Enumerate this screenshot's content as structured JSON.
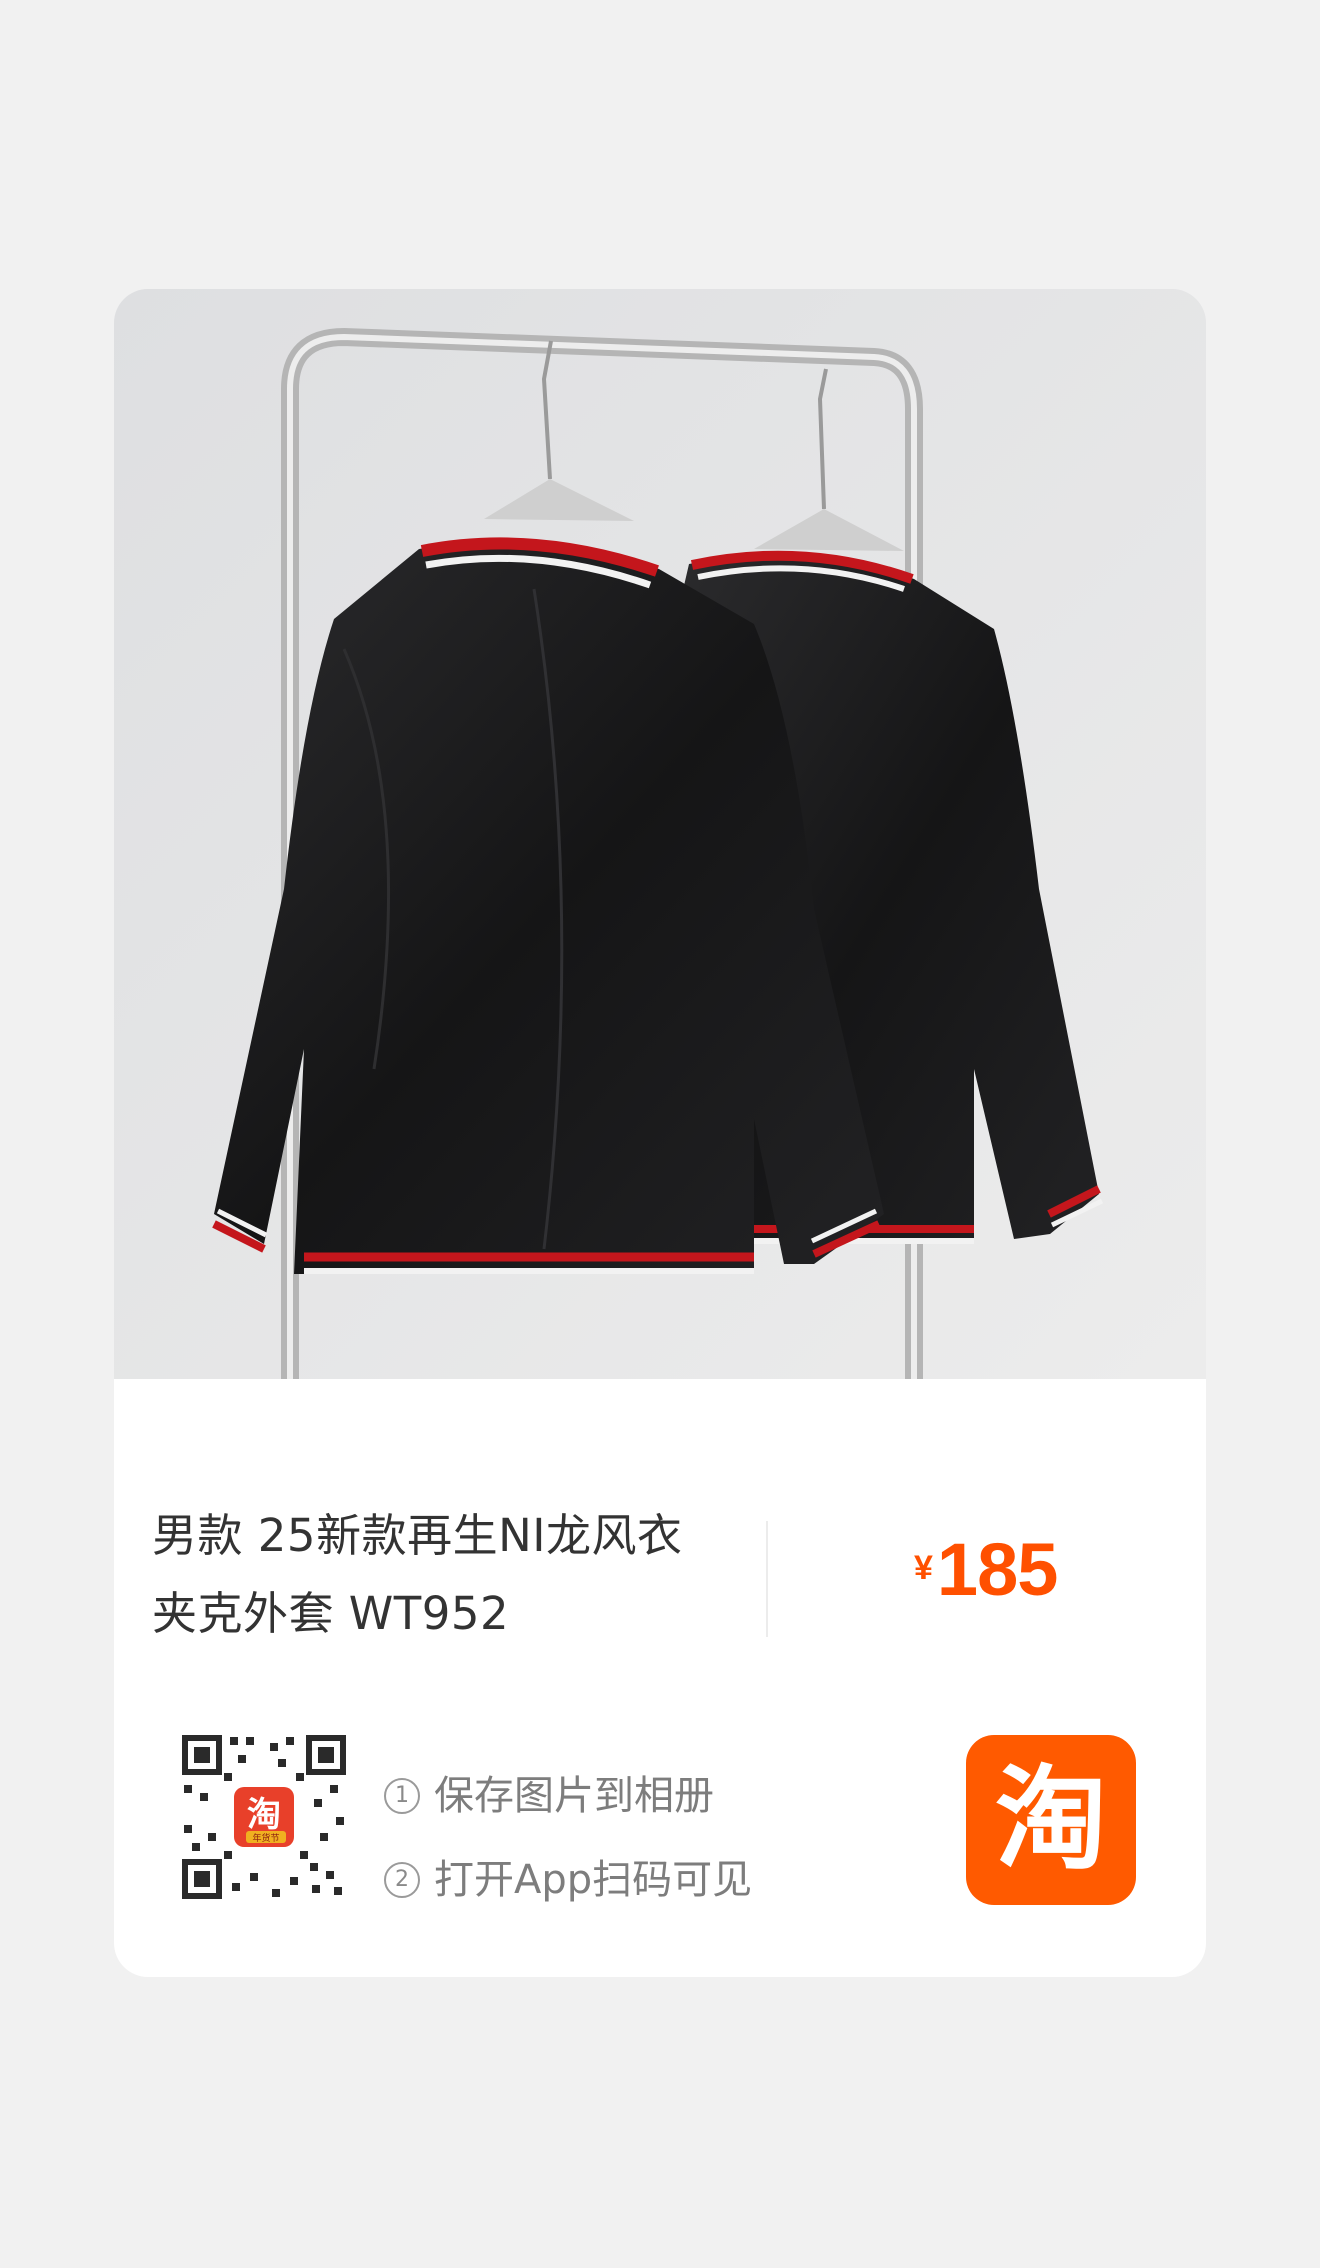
{
  "product": {
    "title_line1": "男款 25新款再生NI龙风衣",
    "title_line2": "夹克外套 WT952",
    "price_symbol": "¥",
    "price_value": "185"
  },
  "share": {
    "step1_num": "1",
    "step1_text": "保存图片到相册",
    "step2_num": "2",
    "step2_text": "打开App扫码可见",
    "qr_center_char": "淘",
    "qr_center_sub": "年货节"
  },
  "brand": {
    "logo_char": "淘"
  },
  "colors": {
    "accent": "#ff5000",
    "logo_bg": "#ff5a00",
    "background": "#f1f1f1",
    "card": "#ffffff"
  },
  "icons": {
    "photo": "product-photo-jackets-on-rack",
    "qr": "qr-code-icon",
    "logo": "taobao-logo-icon"
  }
}
